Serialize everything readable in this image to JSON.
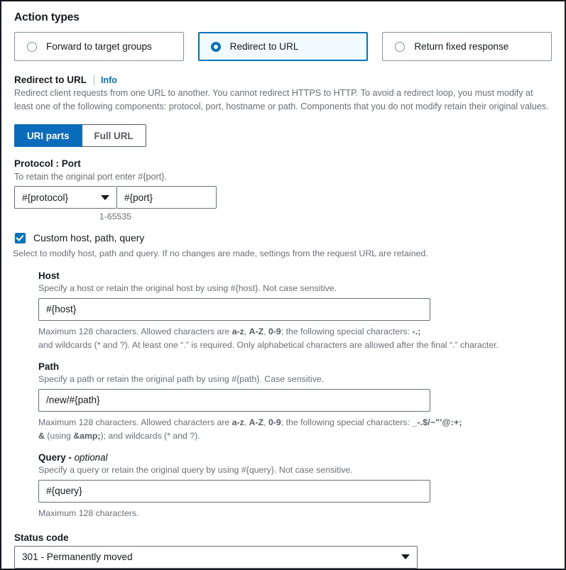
{
  "action_types": {
    "title": "Action types",
    "options": [
      {
        "label": "Forward to target groups",
        "selected": false
      },
      {
        "label": "Redirect to URL",
        "selected": true
      },
      {
        "label": "Return fixed response",
        "selected": false
      }
    ]
  },
  "redirect": {
    "label": "Redirect to URL",
    "info_link": "Info",
    "description": "Redirect client requests from one URL to another. You cannot redirect HTTPS to HTTP. To avoid a redirect loop, you must modify at least one of the following components: protocol, port, hostname or path. Components that you do not modify retain their original values.",
    "segments": [
      {
        "label": "URI parts",
        "active": true
      },
      {
        "label": "Full URL",
        "active": false
      }
    ]
  },
  "protocol_port": {
    "label": "Protocol : Port",
    "description": "To retain the original port enter #{port}.",
    "protocol_value": "#{protocol}",
    "port_value": "#{port}",
    "port_hint": "1-65535"
  },
  "custom": {
    "checkbox_label": "Custom host, path, query",
    "checked": true,
    "description": "Select to modify host, path and query. If no changes are made, settings from the request URL are retained.",
    "host": {
      "label": "Host",
      "description": "Specify a host or retain the original host by using #{host}. Not case sensitive.",
      "value": "#{host}",
      "constraint_line1_a": "Maximum 128 characters. Allowed characters are ",
      "constraint_bold1": "a-z",
      "constraint_sep1": ", ",
      "constraint_bold2": "A-Z",
      "constraint_sep2": ", ",
      "constraint_bold3": "0-9",
      "constraint_line1_b": "; the following special characters: ",
      "constraint_specials": "-.;",
      "constraint_line2": "and wildcards (* and ?). At least one “.” is required. Only alphabetical characters are allowed after the final “.” character."
    },
    "path": {
      "label": "Path",
      "description": "Specify a path or retain the original path by using #{path}. Case sensitive.",
      "value": "/new/#{path}",
      "constraint_line1_a": "Maximum 128 characters. Allowed characters are ",
      "constraint_bold1": "a-z",
      "constraint_sep1": ", ",
      "constraint_bold2": "A-Z",
      "constraint_sep2": ", ",
      "constraint_bold3": "0-9",
      "constraint_line1_b": "; the following special characters: ",
      "constraint_specials": "_-.$/~\"'@:+;",
      "constraint_line2_amp": "&",
      "constraint_line2_a": " (using ",
      "constraint_line2_entity": "&amp;",
      "constraint_line2_b": "); and wildcards (* and ?)."
    },
    "query": {
      "label": "Query - ",
      "label_optional": "optional",
      "description": "Specify a query or retain the original query by using #{query}. Not case sensitive.",
      "value": "#{query}",
      "constraint": "Maximum 128 characters."
    }
  },
  "status_code": {
    "label": "Status code",
    "value": "301 - Permanently moved"
  },
  "colors": {
    "accent": "#0073bb",
    "segment_active": "#0a6cbb",
    "tile_selected_bg": "#f1faff",
    "text": "#16191f",
    "muted": "#687078",
    "border": "#687078"
  }
}
